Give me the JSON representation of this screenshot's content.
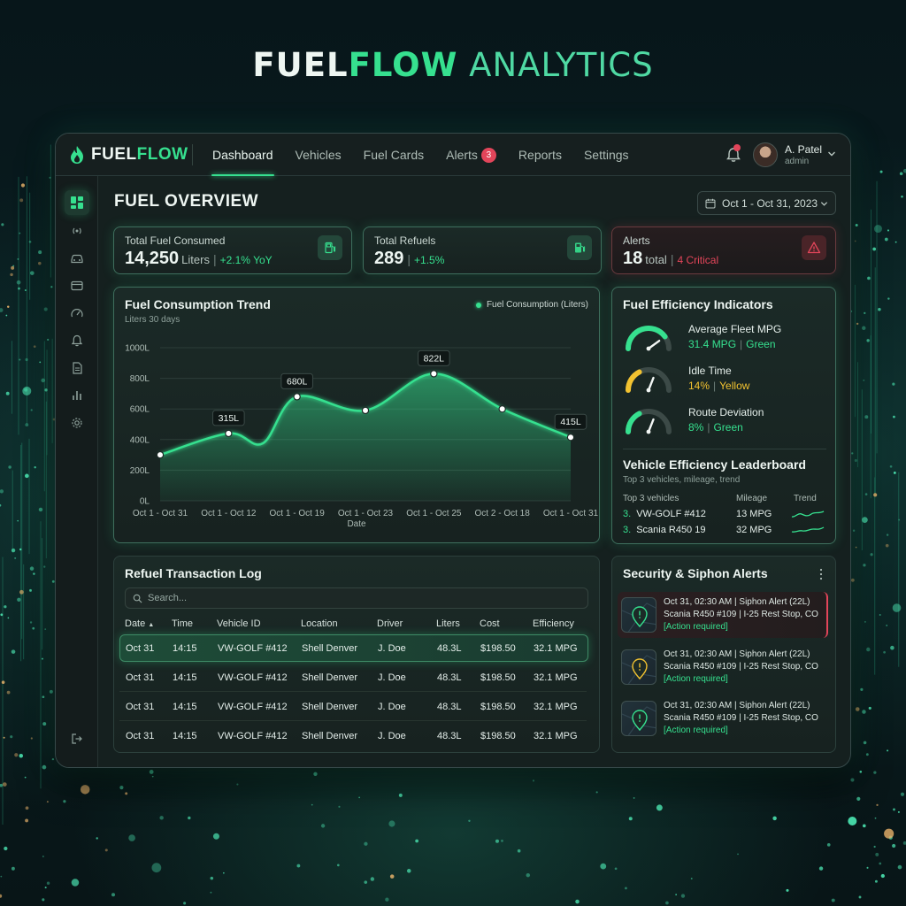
{
  "hero": {
    "word1": "FUEL",
    "word2": "FLOW",
    "word3": " ANALYTICS"
  },
  "brand": {
    "part1": "FUEL",
    "part2": "FLOW",
    "logo_icon": "flame-icon"
  },
  "nav": {
    "items": [
      {
        "label": "Dashboard",
        "active": true
      },
      {
        "label": "Vehicles"
      },
      {
        "label": "Fuel Cards"
      },
      {
        "label": "Alerts",
        "badge": "3"
      },
      {
        "label": "Reports"
      },
      {
        "label": "Settings"
      }
    ]
  },
  "user": {
    "name": "A. Patel",
    "role": "admin"
  },
  "sidebar": {
    "icons": [
      "dashboard-grid-icon",
      "signal-icon",
      "car-icon",
      "card-icon",
      "gauge-icon",
      "bell-icon",
      "document-icon",
      "bar-chart-icon",
      "gear-icon"
    ],
    "bottom_icon": "logout-icon"
  },
  "page": {
    "title": "FUEL OVERVIEW",
    "date_range": "Oct 1 - Oct 31, 2023"
  },
  "stats": {
    "fuel": {
      "label": "Total Fuel Consumed",
      "value": "14,250",
      "unit": "Liters",
      "sep": "|",
      "change": "+2.1% YoY"
    },
    "refuels": {
      "label": "Total Refuels",
      "value": "289",
      "sep": "|",
      "change": "+1.5%"
    },
    "alerts": {
      "label": "Alerts",
      "value": "18",
      "unit": "total",
      "sep": "|",
      "change": "4 Critical"
    }
  },
  "trend": {
    "title": "Fuel Consumption Trend",
    "subtitle": "Liters 30 days",
    "legend": "Fuel Consumption (Liters)",
    "xlabel": "Date"
  },
  "chart_data": {
    "type": "area",
    "title": "Fuel Consumption Trend",
    "subtitle": "Liters 30 days",
    "xlabel": "Date",
    "ylabel": "",
    "y_ticks": [
      "0L",
      "200L",
      "400L",
      "600L",
      "800L",
      "1000L"
    ],
    "ylim": [
      0,
      1000
    ],
    "x_tick_labels": [
      "Oct 1 - Oct 31",
      "Oct 1 - Oct 12",
      "Oct 1 - Oct 19",
      "Oct 1 - Oct 23",
      "Oct 1 - Oct 25",
      "Oct 2 - Oct 18",
      "Oct 1 - Oct 31"
    ],
    "series": [
      {
        "name": "Fuel Consumption (Liters)",
        "points": [
          {
            "x": 0,
            "y": 300
          },
          {
            "x": 1,
            "y": 440,
            "label": "315L"
          },
          {
            "x": 1.5,
            "y": 375
          },
          {
            "x": 2,
            "y": 680,
            "label": "680L"
          },
          {
            "x": 3,
            "y": 590
          },
          {
            "x": 4,
            "y": 830,
            "label": "822L"
          },
          {
            "x": 5,
            "y": 600
          },
          {
            "x": 6,
            "y": 415,
            "label": "415L"
          }
        ]
      }
    ],
    "grid": true,
    "legend_position": "top-right",
    "color": "#36e08f"
  },
  "efficiency": {
    "title": "Fuel Efficiency Indicators",
    "items": [
      {
        "label": "Average Fleet MPG",
        "value": "31.4 MPG",
        "sep": "|",
        "status": "Green",
        "color": "#36e08f",
        "level": 0.8
      },
      {
        "label": "Idle Time",
        "value": "14%",
        "sep": "|",
        "status": "Yellow",
        "color": "#f2c230",
        "level": 0.35
      },
      {
        "label": "Route Deviation",
        "value": "8%",
        "sep": "|",
        "status": "Green",
        "color": "#36e08f",
        "level": 0.35
      }
    ]
  },
  "leaderboard": {
    "title": "Vehicle Efficiency Leaderboard",
    "subtitle": "Top 3 vehicles, mileage, trend",
    "headers": [
      "Top 3 vehicles",
      "Mileage",
      "Trend"
    ],
    "rows": [
      {
        "rank": "3.",
        "vehicle": "VW-GOLF #412",
        "mileage": "13 MPG"
      },
      {
        "rank": "3.",
        "vehicle": "Scania R450 19",
        "mileage": "32 MPG"
      }
    ]
  },
  "log": {
    "title": "Refuel Transaction Log",
    "search_placeholder": "Search...",
    "headers": [
      "Date",
      "Time",
      "Vehicle ID",
      "Location",
      "Driver",
      "Liters",
      "Cost",
      "Efficiency"
    ],
    "rows": [
      [
        "Oct 31",
        "14:15",
        "VW-GOLF #412",
        "Shell Denver",
        "J. Doe",
        "48.3L",
        "$198.50",
        "32.1 MPG"
      ],
      [
        "Oct 31",
        "14:15",
        "VW-GOLF #412",
        "Shell Denver",
        "J. Doe",
        "48.3L",
        "$198.50",
        "32.1 MPG"
      ],
      [
        "Oct 31",
        "14:15",
        "VW-GOLF #412",
        "Shell Denver",
        "J. Doe",
        "48.3L",
        "$198.50",
        "32.1 MPG"
      ],
      [
        "Oct 31",
        "14:15",
        "VW-GOLF #412",
        "Shell Denver",
        "J. Doe",
        "48.3L",
        "$198.50",
        "32.1 MPG"
      ]
    ]
  },
  "security": {
    "title": "Security & Siphon Alerts",
    "items": [
      {
        "line1": "Oct 31, 02:30 AM | Siphon Alert (22L)",
        "line2": "Scania R450 #109 | I-25 Rest Stop, CO",
        "line3": "[Action required]",
        "pin": "green"
      },
      {
        "line1": "Oct 31, 02:30 AM | Siphon Alert (22L)",
        "line2": "Scania R450 #109 | I-25 Rest Stop, CO",
        "line3": "[Action required]",
        "pin": "yellow"
      },
      {
        "line1": "Oct 31, 02:30 AM | Siphon Alert (22L)",
        "line2": "Scania R450 #109 | I-25 Rest Stop, CO",
        "line3": "[Action required]",
        "pin": "green"
      }
    ]
  },
  "colors": {
    "accent": "#36e08f",
    "danger": "#e2455a",
    "warning": "#f2c230",
    "panel": "#15201f"
  }
}
